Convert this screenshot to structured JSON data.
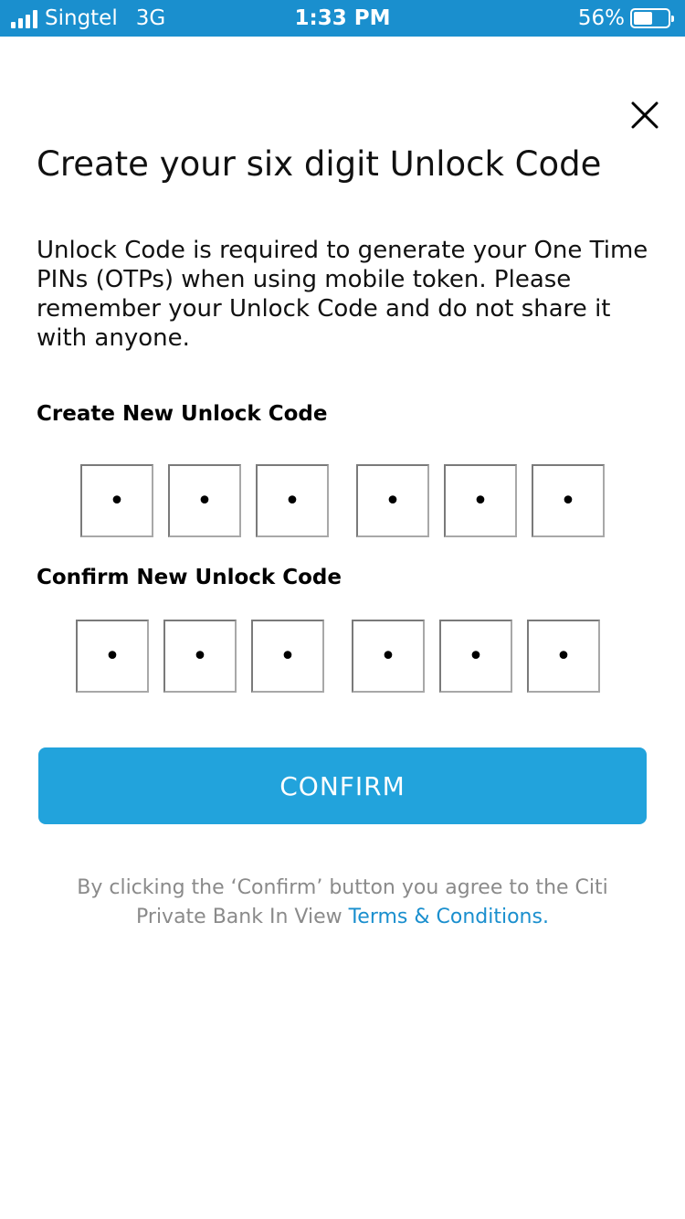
{
  "status_bar": {
    "carrier": "Singtel",
    "network": "3G",
    "time": "1:33 PM",
    "battery_percent_text": "56%",
    "battery_level": 0.56,
    "color": "#1a8fce"
  },
  "close": {
    "icon": "close-icon"
  },
  "title": "Create your six digit Unlock Code",
  "description": "Unlock Code is required to generate your One Time PINs (OTPs) when using mobile token. Please remember your Unlock Code and do not share it with anyone.",
  "create_section": {
    "label": "Create New Unlock Code",
    "digits": [
      "•",
      "•",
      "•",
      "•",
      "•",
      "•"
    ]
  },
  "confirm_section": {
    "label": "Confirm New Unlock Code",
    "digits": [
      "•",
      "•",
      "•",
      "•",
      "•",
      "•"
    ]
  },
  "confirm_button": {
    "label": "CONFIRM",
    "color": "#22a3dc"
  },
  "disclaimer": {
    "line_1": "By clicking the ‘Confirm’ button you agree to the Citi",
    "line_2_prefix": "Private Bank In View ",
    "link_text": "Terms & Conditions."
  }
}
